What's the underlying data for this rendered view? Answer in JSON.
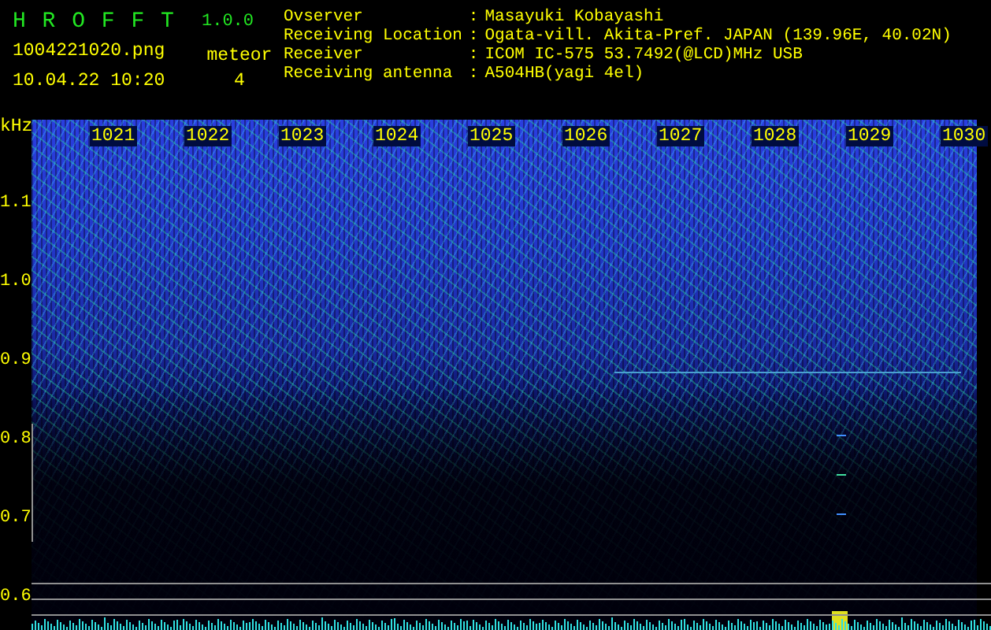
{
  "app": {
    "name": "H R O F F T",
    "version": "1.0.0"
  },
  "file": {
    "name": "1004221020.png",
    "datetime": "10.04.22 10:20"
  },
  "meteor": {
    "label": "meteor",
    "count": "4"
  },
  "info": [
    {
      "label": "Ovserver",
      "separator": ":",
      "value": "Masayuki Kobayashi"
    },
    {
      "label": "Receiving Location",
      "separator": ":",
      "value": "Ogata-vill. Akita-Pref. JAPAN (139.96E, 40.02N)"
    },
    {
      "label": "Receiver",
      "separator": ":",
      "value": "ICOM IC-575 53.7492(@LCD)MHz USB"
    },
    {
      "label": "Receiving antenna",
      "separator": ":",
      "value": "A504HB(yagi 4el)"
    }
  ],
  "spectrogram": {
    "unit": "kHz",
    "time_labels": [
      "1021",
      "1022",
      "1023",
      "1024",
      "1025",
      "1026",
      "1027",
      "1028",
      "1029",
      "1030"
    ],
    "frequency_labels": [
      "1.1",
      "1.0",
      "0.9",
      "0.8",
      "0.7",
      "0.6"
    ]
  }
}
